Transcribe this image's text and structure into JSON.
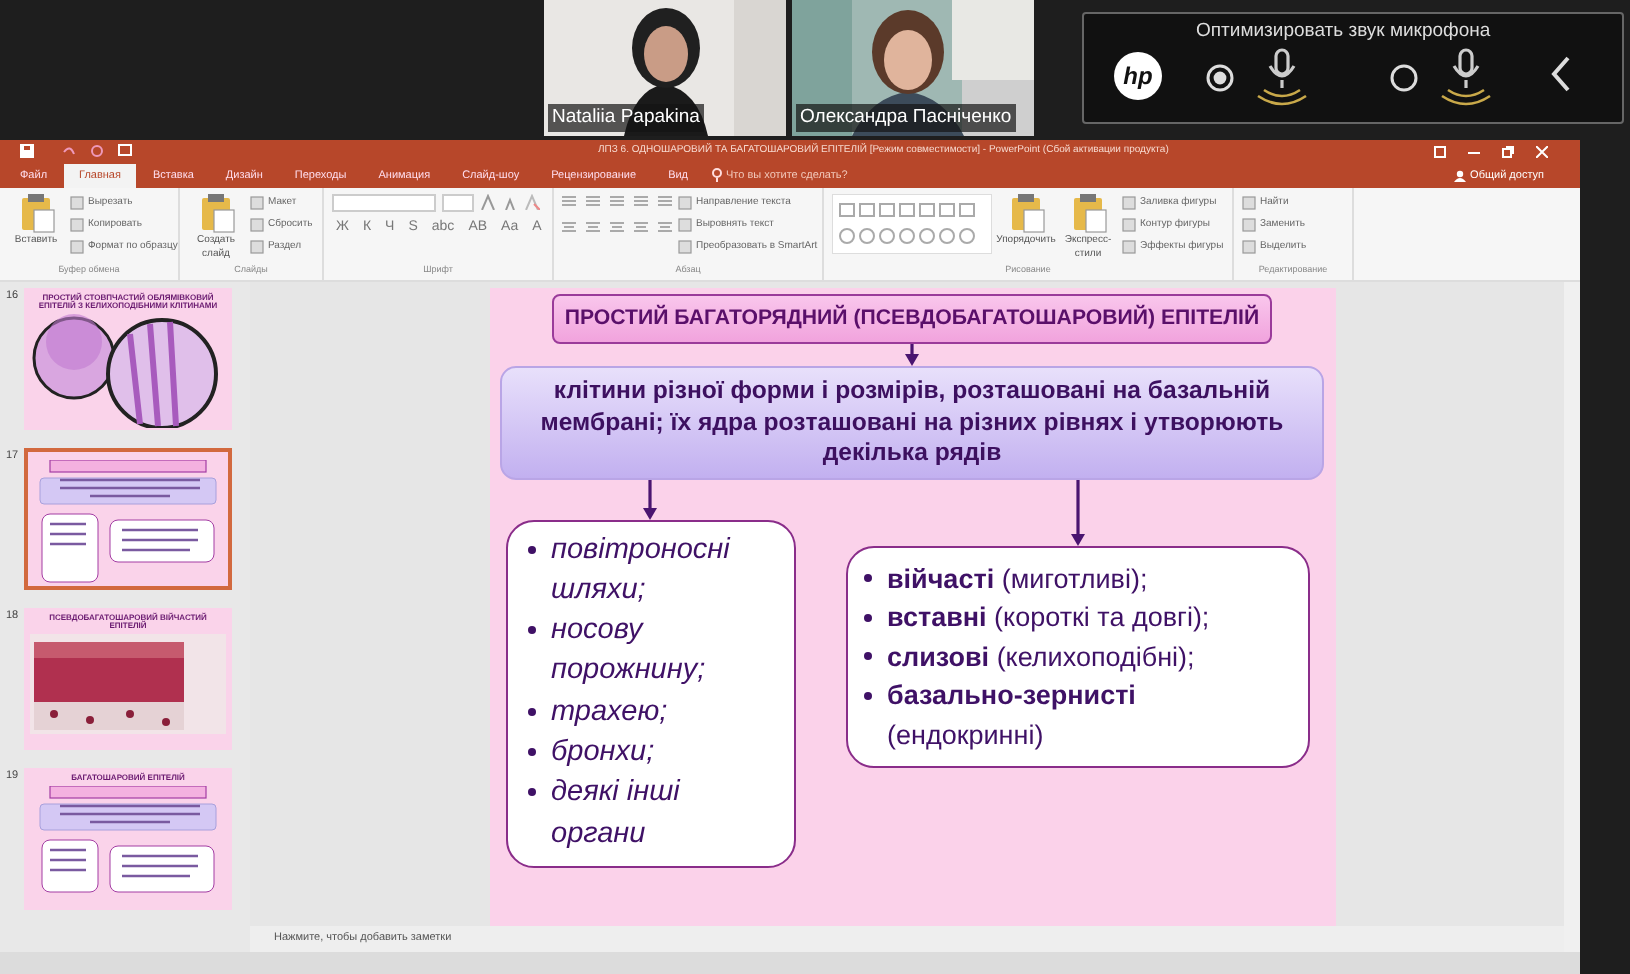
{
  "call": {
    "participants": [
      {
        "name": "Nataliia Papakina",
        "kind": "woman-dark"
      },
      {
        "name": "Олександра  Пасніченко",
        "kind": "woman-light"
      }
    ],
    "audio_panel": {
      "logo": "hp",
      "title": "Оптимизировать звук микрофона",
      "options": [
        {
          "selected": true
        },
        {
          "selected": false
        }
      ]
    }
  },
  "powerpoint": {
    "title": "ЛПЗ 6. ОДНОШАРОВИЙ ТА БАГАТОШАРОВИЙ ЕПІТЕЛІЙ [Режим совместимости] - PowerPoint (Сбой активации продукта)",
    "tabs": [
      {
        "label": "Файл",
        "selected": false
      },
      {
        "label": "Главная",
        "selected": true
      },
      {
        "label": "Вставка",
        "selected": false
      },
      {
        "label": "Дизайн",
        "selected": false
      },
      {
        "label": "Переходы",
        "selected": false
      },
      {
        "label": "Анимация",
        "selected": false
      },
      {
        "label": "Слайд-шоу",
        "selected": false
      },
      {
        "label": "Рецензирование",
        "selected": false
      },
      {
        "label": "Вид",
        "selected": false
      }
    ],
    "tell_me": "Что вы хотите сделать?",
    "share": "Общий доступ",
    "ribbon_groups": [
      {
        "label": "Буфер обмена",
        "items": [
          {
            "kind": "large",
            "label": "Вставить"
          },
          {
            "kind": "small",
            "label": "Вырезать"
          },
          {
            "kind": "small",
            "label": "Копировать"
          },
          {
            "kind": "small",
            "label": "Формат по образцу"
          }
        ]
      },
      {
        "label": "Слайды",
        "items": [
          {
            "kind": "large",
            "label": "Создать слайд"
          },
          {
            "kind": "small",
            "label": "Макет"
          },
          {
            "kind": "small",
            "label": "Сбросить"
          },
          {
            "kind": "small",
            "label": "Раздел"
          }
        ]
      },
      {
        "label": "Шрифт",
        "items": [
          {
            "kind": "glyph",
            "label": "Ж"
          },
          {
            "kind": "glyph",
            "label": "К"
          },
          {
            "kind": "glyph",
            "label": "Ч"
          },
          {
            "kind": "glyph",
            "label": "S"
          },
          {
            "kind": "glyph",
            "label": "abc"
          },
          {
            "kind": "glyph",
            "label": "AB"
          },
          {
            "kind": "glyph",
            "label": "Aa"
          },
          {
            "kind": "glyph",
            "label": "A"
          }
        ]
      },
      {
        "label": "Абзац",
        "items": [
          {
            "kind": "small",
            "label": "Направление текста"
          },
          {
            "kind": "small",
            "label": "Выровнять текст"
          },
          {
            "kind": "small",
            "label": "Преобразовать в SmartArt"
          }
        ]
      },
      {
        "label": "Рисование",
        "items": [
          {
            "kind": "gallery"
          },
          {
            "kind": "large",
            "label": "Упорядочить"
          },
          {
            "kind": "large",
            "label": "Экспресс-стили"
          },
          {
            "kind": "small",
            "label": "Заливка фигуры"
          },
          {
            "kind": "small",
            "label": "Контур фигуры"
          },
          {
            "kind": "small",
            "label": "Эффекты фигуры"
          }
        ]
      },
      {
        "label": "Редактирование",
        "items": [
          {
            "kind": "small",
            "label": "Найти"
          },
          {
            "kind": "small",
            "label": "Заменить"
          },
          {
            "kind": "small",
            "label": "Выделить"
          }
        ]
      }
    ],
    "thumbnails": [
      {
        "number": "16",
        "kind": "circles",
        "title": "ПРОСТИЙ СТОВПЧАСТИЙ ОБЛЯМІВКОВИЙ ЕПІТЕЛІЙ З КЕЛИХОПОДІБНИМИ КЛІТИНАМИ",
        "selected": false
      },
      {
        "number": "17",
        "kind": "scheme",
        "selected": true
      },
      {
        "number": "18",
        "title": "ПСЕВДОБАГАТОШАРОВИЙ ВІЙЧАСТИЙ ЕПІТЕЛІЙ",
        "selected": false
      },
      {
        "number": "19",
        "kind": "scheme",
        "title": "БАГАТОШАРОВИЙ ЕПІТЕЛІЙ",
        "selected": false
      }
    ],
    "slide": {
      "title": "ПРОСТИЙ БАГАТОРЯДНИЙ (ПСЕВДОБАГАТОШАРОВИЙ) ЕПІТЕЛІЙ",
      "definition": "клітини різної форми і розмірів, розташовані на базальній мембрані; їх ядра розташовані на різних рівнях і утворюють декілька рядів",
      "left_items": [
        "повітроносні шляхи;",
        "носову порожнину;",
        "трахею;",
        "бронхи;",
        "деякі інші органи"
      ],
      "right_items": [
        "**війчасті** (миготливі);",
        "**вставні**  (короткі та довгі);",
        "**слизові**  (келихоподібні);",
        "**базально-зернисті** (ендокринні)"
      ]
    },
    "notes_placeholder": "Нажмите, чтобы добавить заметки"
  }
}
